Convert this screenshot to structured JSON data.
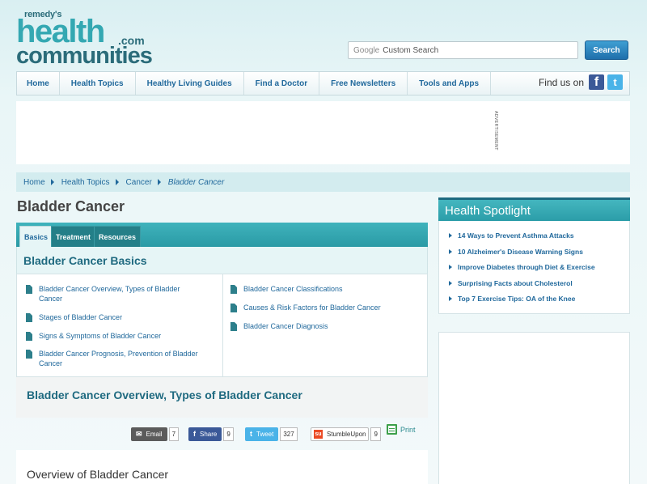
{
  "header": {
    "logo_top": "remedy's",
    "logo_health": "health",
    "logo_dotcom": ".com",
    "logo_communities": "communities",
    "search_brand": "Google",
    "search_placeholder": "Custom Search",
    "search_button": "Search"
  },
  "nav": {
    "items": [
      "Home",
      "Health Topics",
      "Healthy Living Guides",
      "Find a Doctor",
      "Free Newsletters",
      "Tools and Apps"
    ],
    "find_us": "Find us on",
    "facebook_glyph": "f",
    "twitter_glyph": "t"
  },
  "ad": {
    "label": "ADVERTISEMENT"
  },
  "breadcrumb": [
    "Home",
    "Health Topics",
    "Cancer",
    "Bladder Cancer"
  ],
  "page_title": "Bladder Cancer",
  "tabs": [
    "Basics",
    "Treatment",
    "Resources"
  ],
  "basics_heading": "Bladder Cancer Basics",
  "links_left": [
    "Bladder Cancer Overview, Types of Bladder Cancer",
    "Stages of Bladder Cancer",
    "Signs & Symptoms of Bladder Cancer",
    "Bladder Cancer Prognosis, Prevention of Bladder Cancer"
  ],
  "links_right": [
    "Bladder Cancer Classifications",
    "Causes & Risk Factors for Bladder Cancer",
    "Bladder Cancer Diagnosis"
  ],
  "article_heading": "Bladder Cancer Overview, Types of Bladder Cancer",
  "share": {
    "email_label": "Email",
    "email_count": "7",
    "share_label": "Share",
    "share_count": "9",
    "tweet_label": "Tweet",
    "tweet_count": "327",
    "stumble_label": "StumbleUpon",
    "stumble_count": "9",
    "print_label": "Print"
  },
  "overview_heading": "Overview of Bladder Cancer",
  "spotlight": {
    "title": "Health Spotlight",
    "items": [
      "14 Ways to Prevent Asthma Attacks",
      "10 Alzheimer's Disease Warning Signs",
      "Improve Diabetes through Diet & Exercise",
      "Surprising Facts about Cholesterol",
      "Top 7 Exercise Tips: OA of the Knee"
    ]
  },
  "colors": {
    "teal": "#34a8b2",
    "dark_teal": "#2b6c7a",
    "link_blue": "#21699c",
    "facebook": "#3b5998",
    "twitter": "#4ab3e8",
    "stumble": "#eb4924"
  }
}
